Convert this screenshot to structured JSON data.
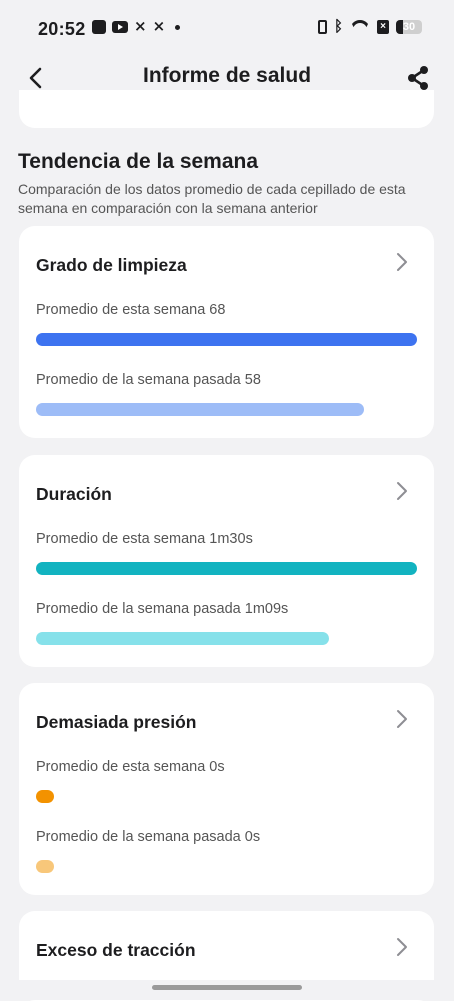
{
  "status_bar": {
    "time": "20:52",
    "battery": "30",
    "notification_icons": [
      "app-icon",
      "youtube-icon",
      "capcut-icon",
      "capcut-icon",
      "dot"
    ],
    "system_icons": [
      "vibrate-icon",
      "bluetooth-icon",
      "wifi-icon",
      "sim-off-icon",
      "battery-icon"
    ]
  },
  "header": {
    "title": "Informe de salud",
    "back_icon": "chevron-left-icon",
    "share_icon": "share-icon"
  },
  "section": {
    "title": "Tendencia de la semana",
    "subtitle": "Comparación de los datos promedio de cada cepillado de esta semana en comparación con la semana anterior"
  },
  "colors": {
    "blue": "#3d73f0",
    "blue_light": "#9dbcf7",
    "teal": "#12b3c0",
    "teal_light": "#86e1ea",
    "orange": "#f39200",
    "orange_light": "#f8c77a"
  },
  "cards": [
    {
      "title": "Grado de limpieza",
      "this_week_label": "Promedio de esta semana 68",
      "last_week_label": "Promedio de la semana pasada 58",
      "this_week_level": 1.0,
      "last_week_level": 0.86
    },
    {
      "title": "Duración",
      "this_week_label": "Promedio de esta semana 1m30s",
      "last_week_label": "Promedio de la semana pasada 1m09s",
      "this_week_level": 1.0,
      "last_week_level": 0.77
    },
    {
      "title": "Demasiada presión",
      "this_week_label": "Promedio de esta semana 0s",
      "last_week_label": "Promedio de la semana pasada 0s",
      "this_week_level": 0,
      "last_week_level": 0
    },
    {
      "title": "Exceso de tracción"
    }
  ]
}
